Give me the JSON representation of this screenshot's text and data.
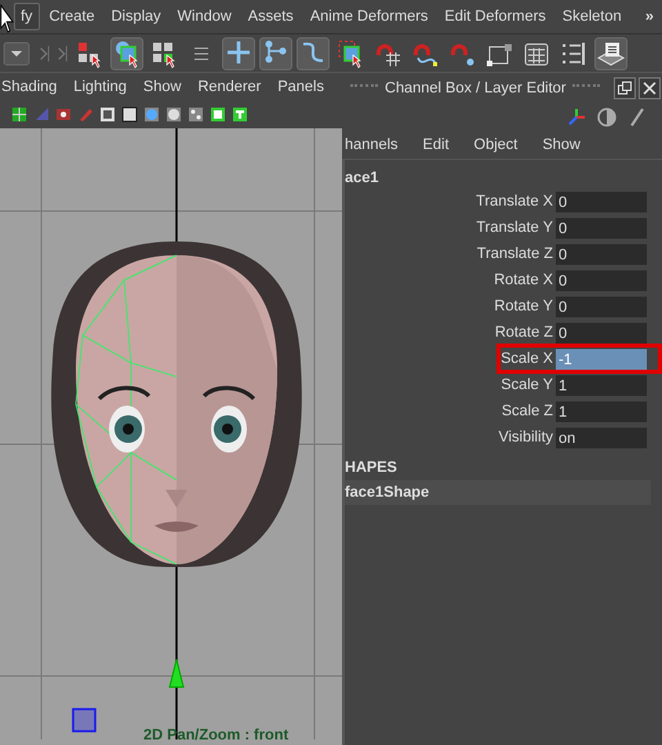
{
  "menu_bar": {
    "items": [
      {
        "label": "fy",
        "selected": true
      },
      {
        "label": "Create",
        "selected": false
      },
      {
        "label": "Display",
        "selected": false
      },
      {
        "label": "Window",
        "selected": false
      },
      {
        "label": "Assets",
        "selected": false
      },
      {
        "label": "Anime Deformers",
        "selected": false
      },
      {
        "label": "Edit Deformers",
        "selected": false
      },
      {
        "label": "Skeleton",
        "selected": false
      }
    ],
    "overflow": "»"
  },
  "toolbar": [
    {
      "kind": "dropdown",
      "selected": false
    },
    {
      "kind": "handle",
      "selected": false
    },
    {
      "kind": "handle",
      "selected": false
    },
    {
      "kind": "hierarchy",
      "selected": false
    },
    {
      "kind": "object",
      "selected": true
    },
    {
      "kind": "component",
      "selected": false
    },
    {
      "kind": "lines",
      "selected": false
    },
    {
      "kind": "grid",
      "selected": true
    },
    {
      "kind": "curve-nodes",
      "selected": true
    },
    {
      "kind": "curve",
      "selected": true
    },
    {
      "kind": "dashed-select",
      "selected": false
    },
    {
      "kind": "magnet-grid",
      "selected": false
    },
    {
      "kind": "magnet-curve",
      "selected": false
    },
    {
      "kind": "magnet-point",
      "selected": false
    },
    {
      "kind": "bounding-box",
      "selected": false
    },
    {
      "kind": "table",
      "selected": false
    },
    {
      "kind": "checklist",
      "selected": false
    },
    {
      "kind": "stack",
      "selected": true
    }
  ],
  "viewport": {
    "menus": [
      "Shading",
      "Lighting",
      "Show",
      "Renderer",
      "Panels"
    ],
    "camera_label": "2D Pan/Zoom : front"
  },
  "channel_box": {
    "title": "Channel Box / Layer Editor",
    "menus": [
      "hannels",
      "Edit",
      "Object",
      "Show"
    ],
    "object_name": "ace1",
    "channels": [
      {
        "name": "Translate X",
        "value": "0",
        "selected": false,
        "outlined": false
      },
      {
        "name": "Translate Y",
        "value": "0",
        "selected": false,
        "outlined": false
      },
      {
        "name": "Translate Z",
        "value": "0",
        "selected": false,
        "outlined": false
      },
      {
        "name": "Rotate X",
        "value": "0",
        "selected": false,
        "outlined": false
      },
      {
        "name": "Rotate Y",
        "value": "0",
        "selected": false,
        "outlined": false
      },
      {
        "name": "Rotate Z",
        "value": "0",
        "selected": false,
        "outlined": false
      },
      {
        "name": "Scale X",
        "value": "-1",
        "selected": true,
        "outlined": true
      },
      {
        "name": "Scale Y",
        "value": "1",
        "selected": false,
        "outlined": false
      },
      {
        "name": "Scale Z",
        "value": "1",
        "selected": false,
        "outlined": false
      },
      {
        "name": "Visibility",
        "value": "on",
        "selected": false,
        "outlined": false
      }
    ],
    "shapes_header": "HAPES",
    "shape_name": "face1Shape"
  }
}
